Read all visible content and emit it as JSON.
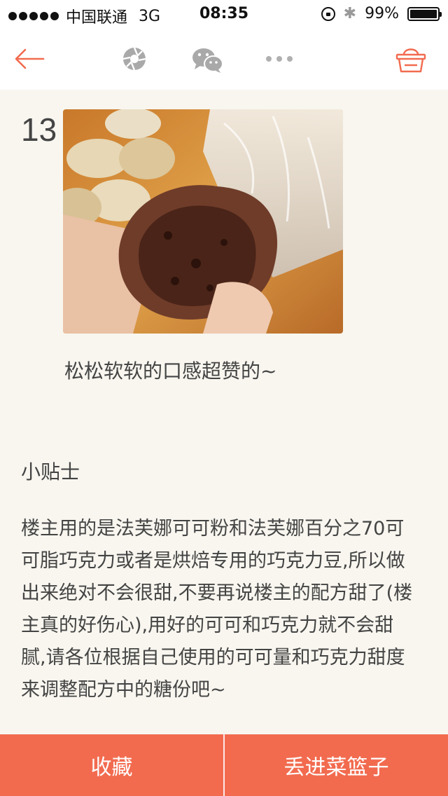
{
  "status_bar": {
    "carrier": "中国联通",
    "network": "3G",
    "time": "08:35",
    "battery": "99%"
  },
  "nav": {
    "back_icon": "arrow-left-icon",
    "icons": [
      "camera-aperture-icon",
      "wechat-icon",
      "more-dots-icon",
      "basket-icon"
    ],
    "accent_color": "#f26b4f"
  },
  "step": {
    "number": "13",
    "caption": "松松软软的口感超赞的~"
  },
  "tips": {
    "heading": "小贴士",
    "lines": [
      "楼主用的是法芙娜可可粉和法芙娜百分之70可",
      "可脂巧克力或者是烘焙专用的巧克力豆,所以做",
      "出来绝对不会很甜,不要再说楼主的配方甜了(楼",
      "主真的好伤心),用好的可可和巧克力就不会甜",
      "腻,请各位根据自己使用的可可量和巧克力甜度",
      "来调整配方中的糖份吧~"
    ]
  },
  "bottom_bar": {
    "favorite_label": "收藏",
    "add_basket_label": "丢进菜篮子",
    "color": "#f26b4f"
  }
}
